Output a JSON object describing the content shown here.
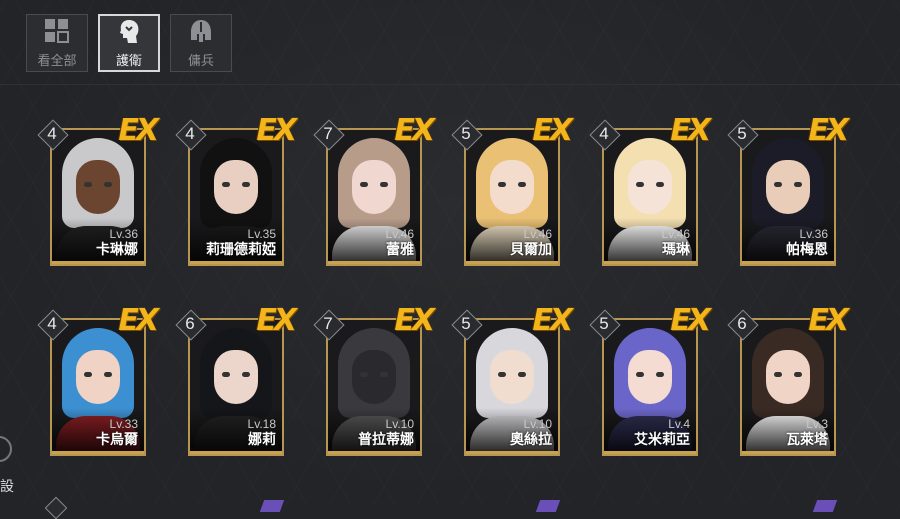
{
  "tabs": [
    {
      "label": "看全部",
      "icon": "grid-icon",
      "active": false
    },
    {
      "label": "護衛",
      "icon": "head-icon",
      "active": true
    },
    {
      "label": "傭兵",
      "icon": "helmet-icon",
      "active": false
    }
  ],
  "badge_text": "EX",
  "left_edge_text": "設",
  "rows": [
    [
      {
        "rank": "4",
        "level": "Lv.36",
        "name": "卡琳娜",
        "hair": "#c9c9cc",
        "skin": "#6b4530",
        "outfit": "#222"
      },
      {
        "rank": "4",
        "level": "Lv.35",
        "name": "莉珊德莉婭",
        "hair": "#111",
        "skin": "#e8cfc2",
        "outfit": "#1b1b1b"
      },
      {
        "rank": "7",
        "level": "Lv.46",
        "name": "蕾雅",
        "hair": "#b79c8a",
        "skin": "#f0d8d0",
        "outfit": "#eee"
      },
      {
        "rank": "5",
        "level": "Lv.46",
        "name": "貝爾加",
        "hair": "#e9c074",
        "skin": "#f3dccb",
        "outfit": "#f2e4c8"
      },
      {
        "rank": "4",
        "level": "Lv.46",
        "name": "瑪琳",
        "hair": "#f3dfb0",
        "skin": "#f6e3d8",
        "outfit": "#fff"
      },
      {
        "rank": "5",
        "level": "Lv.36",
        "name": "帕梅恩",
        "hair": "#1c1c28",
        "skin": "#e9cdb9",
        "outfit": "#2a2a35"
      }
    ],
    [
      {
        "rank": "4",
        "level": "Lv.33",
        "name": "卡烏爾",
        "hair": "#3c8fd0",
        "skin": "#f1d3c5",
        "outfit": "#8a1f24"
      },
      {
        "rank": "6",
        "level": "Lv.18",
        "name": "娜莉",
        "hair": "#15161a",
        "skin": "#ecd6cc",
        "outfit": "#222"
      },
      {
        "rank": "7",
        "level": "Lv.10",
        "name": "普拉蒂娜",
        "hair": "#3a3a3e",
        "skin": "#2a2a2e",
        "outfit": "#555"
      },
      {
        "rank": "5",
        "level": "Lv.10",
        "name": "奧絲拉",
        "hair": "#d8d8dc",
        "skin": "#f1ddd0",
        "outfit": "#cfcfd2"
      },
      {
        "rank": "5",
        "level": "Lv.4",
        "name": "艾米莉亞",
        "hair": "#6a66c9",
        "skin": "#f4dcd2",
        "outfit": "#2e2e52"
      },
      {
        "rank": "6",
        "level": "Lv.3",
        "name": "瓦萊塔",
        "hair": "#3a2a24",
        "skin": "#f0d4c6",
        "outfit": "#f2f2f2"
      }
    ]
  ]
}
